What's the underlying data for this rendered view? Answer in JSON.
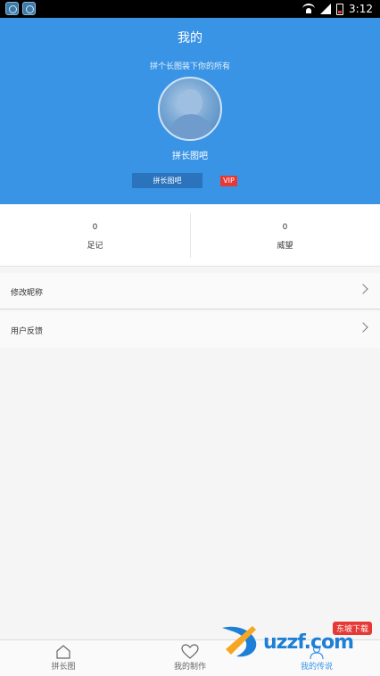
{
  "status_bar": {
    "time": "3:12"
  },
  "header": {
    "title": "我的",
    "slogan": "拼个长图装下你的所有",
    "username": "拼长图吧",
    "button_label": "拼长图吧",
    "vip_badge": "VIP"
  },
  "stats": [
    {
      "value": "0",
      "label": "足记"
    },
    {
      "value": "0",
      "label": "威望"
    }
  ],
  "menu": [
    {
      "label": "修改昵称"
    },
    {
      "label": "用户反馈"
    }
  ],
  "tabs": [
    {
      "label": "拼长图",
      "icon": "home-icon",
      "active": false
    },
    {
      "label": "我的制作",
      "icon": "heart-icon",
      "active": false
    },
    {
      "label": "我的传说",
      "icon": "person-icon",
      "active": true
    }
  ],
  "watermark": {
    "badge": "东坡下载",
    "text": "uzzf.com"
  },
  "colors": {
    "primary": "#3a94e6",
    "vip": "#e53935"
  }
}
